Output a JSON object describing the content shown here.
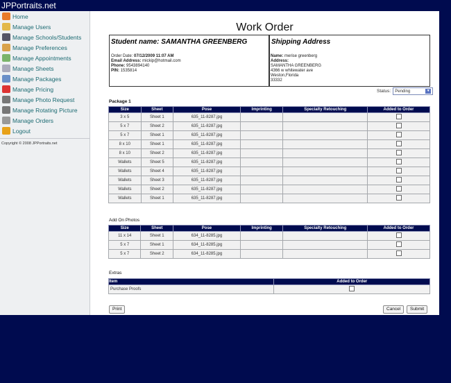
{
  "app": {
    "brand": "JPPortraits.net"
  },
  "sidebar": {
    "items": [
      {
        "label": "Home",
        "icon": "home-icon",
        "color": "#e87a2a"
      },
      {
        "label": "Manage Users",
        "icon": "users-icon",
        "color": "#e3b84a"
      },
      {
        "label": "Manage Schools/Students",
        "icon": "students-icon",
        "color": "#556"
      },
      {
        "label": "Manage Preferences",
        "icon": "preferences-icon",
        "color": "#d9a24b"
      },
      {
        "label": "Manage Appointments",
        "icon": "appointments-icon",
        "color": "#7ab46a"
      },
      {
        "label": "Manage Sheets",
        "icon": "sheets-icon",
        "color": "#aab"
      },
      {
        "label": "Manage Packages",
        "icon": "packages-icon",
        "color": "#6a8fc8"
      },
      {
        "label": "Manage Pricing",
        "icon": "pricing-icon",
        "color": "#d33"
      },
      {
        "label": "Manage Photo Request",
        "icon": "photo-request-icon",
        "color": "#777"
      },
      {
        "label": "Manage Rotating Picture",
        "icon": "rotating-picture-icon",
        "color": "#777"
      },
      {
        "label": "Manage Orders",
        "icon": "orders-icon",
        "color": "#999"
      },
      {
        "label": "Logout",
        "icon": "logout-icon",
        "color": "#e8a21a"
      }
    ],
    "copyright": "Copyright © 2008 JPPortraits.net"
  },
  "main": {
    "title": "Work Order",
    "student": {
      "heading": "Student name: SAMANTHA GREENBERG",
      "order_date_label": "Order Date:",
      "order_date": "07/12/2009 11:07 AM",
      "email_label": "Email Address:",
      "email": "mickip@hotmail.com",
      "phone_label": "Phone:",
      "phone": "9543894140",
      "pin_label": "PIN:",
      "pin": "1535814"
    },
    "shipping": {
      "heading": "Shipping Address",
      "name_label": "Name:",
      "name": "merise greenberg",
      "address_label": "Address:",
      "line1": "SAMANTHA GREENBERG",
      "line2": "4366 w whitewater ave",
      "line3": "Weston,Florida",
      "line4": "33332"
    },
    "status": {
      "label": "Status:",
      "value": "Pending"
    },
    "package": {
      "label": "Package 1",
      "headers": [
        "Size",
        "Sheet",
        "Pose",
        "Imprinting",
        "Specialty Retouching",
        "Added to Order"
      ],
      "rows": [
        [
          "3 x 5",
          "Sheet 1",
          "635_11-8287.jpg"
        ],
        [
          "5 x 7",
          "Sheet 2",
          "635_11-8287.jpg"
        ],
        [
          "5 x 7",
          "Sheet 1",
          "635_11-8287.jpg"
        ],
        [
          "8 x 10",
          "Sheet 1",
          "635_11-8287.jpg"
        ],
        [
          "8 x 10",
          "Sheet 2",
          "635_11-8287.jpg"
        ],
        [
          "Wallets",
          "Sheet 5",
          "635_11-8287.jpg"
        ],
        [
          "Wallets",
          "Sheet 4",
          "635_11-8287.jpg"
        ],
        [
          "Wallets",
          "Sheet 3",
          "635_11-8287.jpg"
        ],
        [
          "Wallets",
          "Sheet 2",
          "635_11-8287.jpg"
        ],
        [
          "Wallets",
          "Sheet 1",
          "635_11-8287.jpg"
        ]
      ]
    },
    "addon": {
      "label": "Add On Photos",
      "headers": [
        "Size",
        "Sheet",
        "Pose",
        "Imprinting",
        "Specialty Retouching",
        "Added to Order"
      ],
      "rows": [
        [
          "11 x 14",
          "Sheet 1",
          "634_11-8285.jpg"
        ],
        [
          "5 x 7",
          "Sheet 1",
          "634_11-8285.jpg"
        ],
        [
          "5 x 7",
          "Sheet 2",
          "634_11-8285.jpg"
        ]
      ]
    },
    "extras": {
      "label": "Extras",
      "headers": [
        "Item",
        "Added to Order"
      ],
      "rows": [
        [
          "Purchase Proofs"
        ]
      ]
    },
    "buttons": {
      "print": "Print",
      "cancel": "Cancel",
      "submit": "Submit"
    }
  }
}
